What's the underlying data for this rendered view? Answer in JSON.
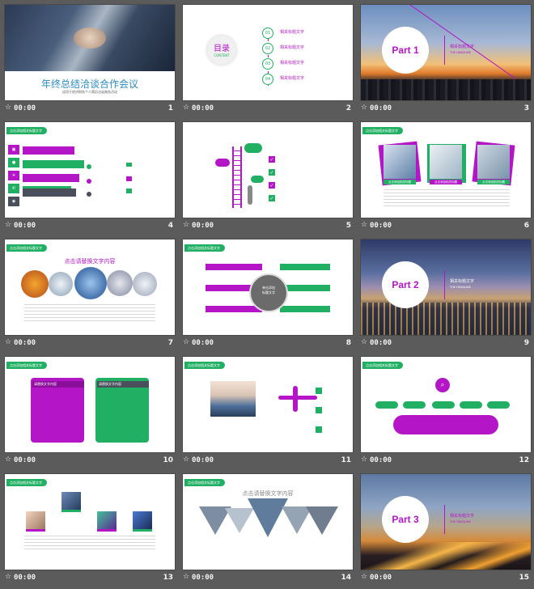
{
  "colors": {
    "purple": "#b415c7",
    "green": "#21b063",
    "bg": "#5b5b5b"
  },
  "meta_time": "00:00",
  "star_icon": "star-icon",
  "slides": [
    {
      "num": "1",
      "title": "年终总结洽谈合作会议",
      "subtitle": "适用于经济财务个人简历洽谈商务活动",
      "icons": [
        "handshake-photo"
      ]
    },
    {
      "num": "2",
      "toc_title": "目录",
      "toc_sub": "CONTENT",
      "items": [
        {
          "n": "01",
          "label": "相关标题文字"
        },
        {
          "n": "02",
          "label": "相关标题文字"
        },
        {
          "n": "03",
          "label": "相关标题文字"
        },
        {
          "n": "04",
          "label": "相关标题文字"
        }
      ]
    },
    {
      "num": "3",
      "part": "Part 1",
      "title": "相关标题文字",
      "sub": "THE HEADLINE"
    },
    {
      "num": "4",
      "tag": "点击添加相关标题文字"
    },
    {
      "num": "5",
      "tag": "点击添加相关标题文字"
    },
    {
      "num": "6",
      "tag": "点击添加相关标题文字",
      "captions": [
        "点击添加相关标题",
        "点击添加相关标题",
        "点击添加相关标题"
      ]
    },
    {
      "num": "7",
      "tag": "点击添加相关标题文字",
      "heading": "点击请替换文字内容"
    },
    {
      "num": "8",
      "tag": "点击添加相关标题文字",
      "center": "单击添加\n标题文字"
    },
    {
      "num": "9",
      "part": "Part 2",
      "title": "相关标题文字",
      "sub": "THE HEADLINE"
    },
    {
      "num": "10",
      "tag": "点击添加相关标题文字",
      "box1": "请替换文字内容",
      "box2": "请替换文字内容"
    },
    {
      "num": "11",
      "tag": "点击添加相关标题文字"
    },
    {
      "num": "12",
      "tag": "点击添加相关标题文字"
    },
    {
      "num": "13",
      "tag": "点击添加相关标题文字"
    },
    {
      "num": "14",
      "tag": "点击添加相关标题文字",
      "heading": "点击请替换文字内容"
    },
    {
      "num": "15",
      "part": "Part 3",
      "title": "相关标题文字",
      "sub": "THE HEADLINE"
    }
  ]
}
